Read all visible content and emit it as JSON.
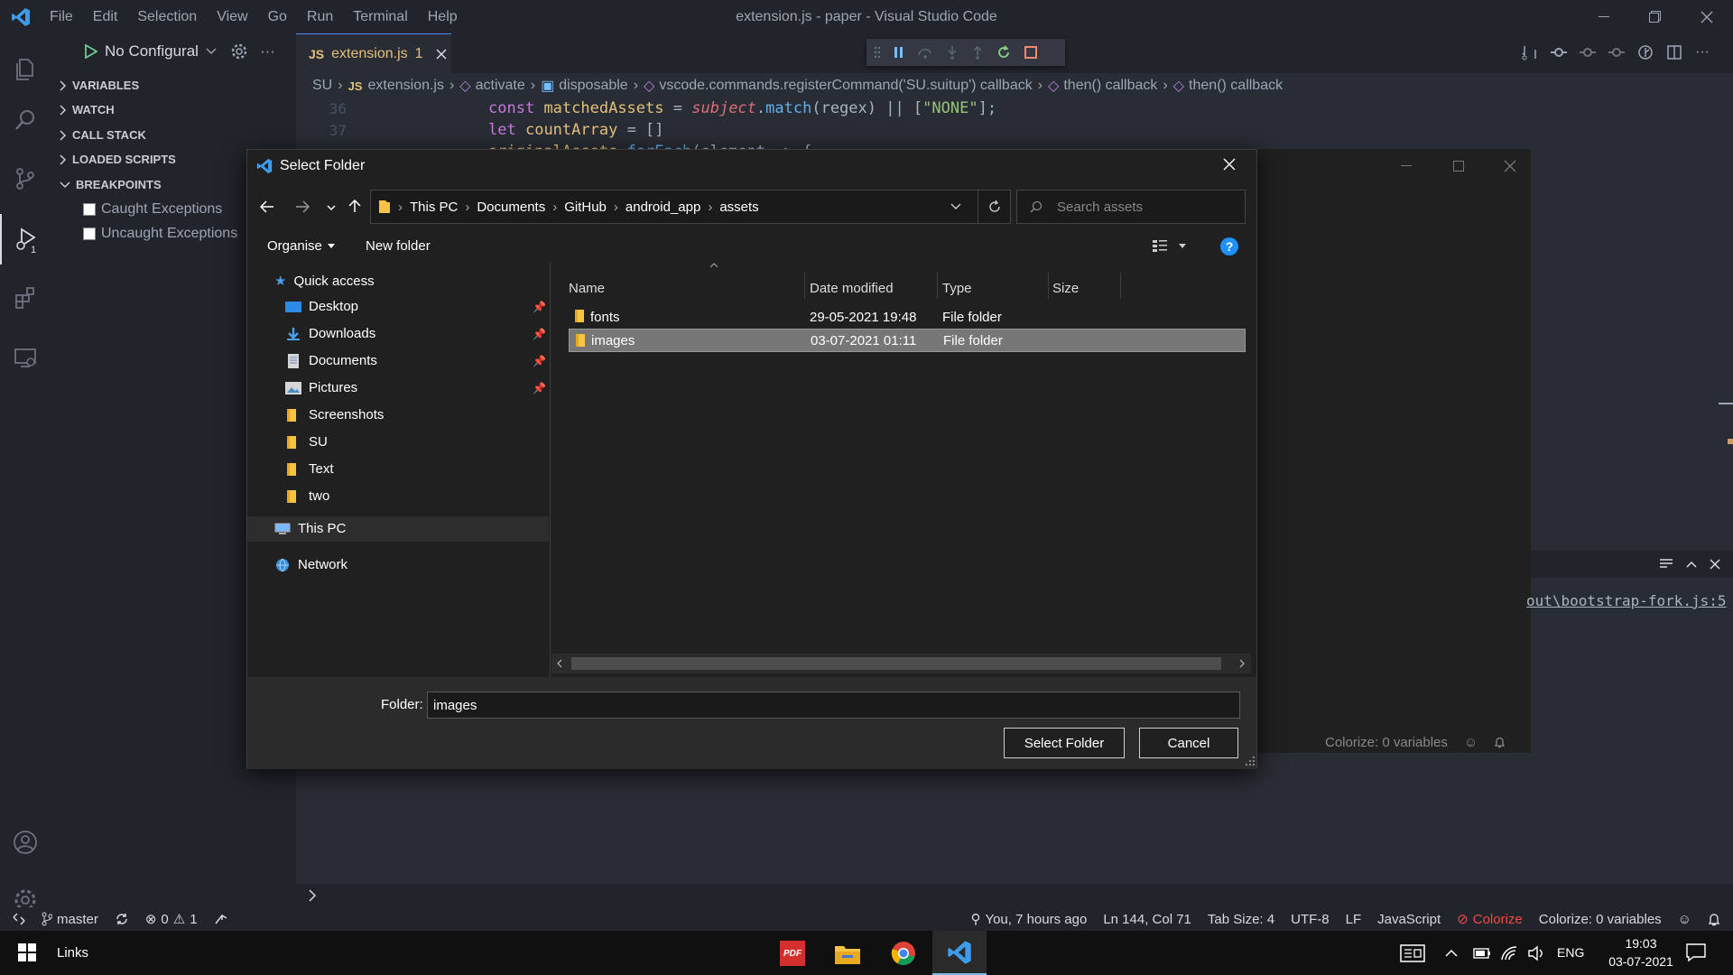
{
  "window": {
    "title": "extension.js - paper - Visual Studio Code",
    "menu": [
      "File",
      "Edit",
      "Selection",
      "View",
      "Go",
      "Run",
      "Terminal",
      "Help"
    ]
  },
  "debug": {
    "config_label": "No Configural",
    "sections": [
      "VARIABLES",
      "WATCH",
      "CALL STACK",
      "LOADED SCRIPTS",
      "BREAKPOINTS"
    ],
    "breakpoints": [
      "Caught Exceptions",
      "Uncaught Exceptions"
    ],
    "activity_badge": "1"
  },
  "editor": {
    "tab_label": "extension.js",
    "tab_problem_count": "1",
    "tab_lang_badge": "JS",
    "breadcrumb": [
      "SU",
      "extension.js",
      "activate",
      "disposable",
      "vscode.commands.registerCommand('SU.suitup') callback",
      "then() callback",
      "then() callback"
    ],
    "lines": [
      {
        "num": "36"
      },
      {
        "num": "37"
      }
    ],
    "terminal_link": "out\\bootstrap-fork.js:5",
    "panel_status": "Colorize: 0 variables"
  },
  "dialog": {
    "title": "Select Folder",
    "path": [
      "This PC",
      "Documents",
      "GitHub",
      "android_app",
      "assets"
    ],
    "search_placeholder": "Search assets",
    "organise": "Organise",
    "new_folder": "New folder",
    "help_glyph": "?",
    "nav": {
      "quick_access": "Quick access",
      "items": [
        "Desktop",
        "Downloads",
        "Documents",
        "Pictures",
        "Screenshots",
        "SU",
        "Text",
        "two"
      ],
      "this_pc": "This PC",
      "network": "Network"
    },
    "columns": [
      "Name",
      "Date modified",
      "Type",
      "Size"
    ],
    "files": [
      {
        "name": "fonts",
        "date": "29-05-2021 19:48",
        "type": "File folder"
      },
      {
        "name": "images",
        "date": "03-07-2021 01:11",
        "type": "File folder"
      }
    ],
    "folder_label": "Folder:",
    "folder_value": "images",
    "select_button": "Select Folder",
    "cancel_button": "Cancel"
  },
  "statusbar": {
    "branch": "master",
    "errors": "0",
    "warnings": "1",
    "blame": "You, 7 hours ago",
    "position": "Ln 144, Col 71",
    "tab_size": "Tab Size: 4",
    "encoding": "UTF-8",
    "eol": "LF",
    "language": "JavaScript",
    "colorize": "Colorize",
    "colorize_vars": "Colorize: 0 variables"
  },
  "taskbar": {
    "links": "Links",
    "lang": "ENG",
    "time": "19:03",
    "date": "03-07-2021",
    "pdf_label": "PDF"
  },
  "colors": {
    "accent": "#528bff",
    "selection": "#777777",
    "colorize": "#f44747",
    "help": "#1e90ff"
  }
}
